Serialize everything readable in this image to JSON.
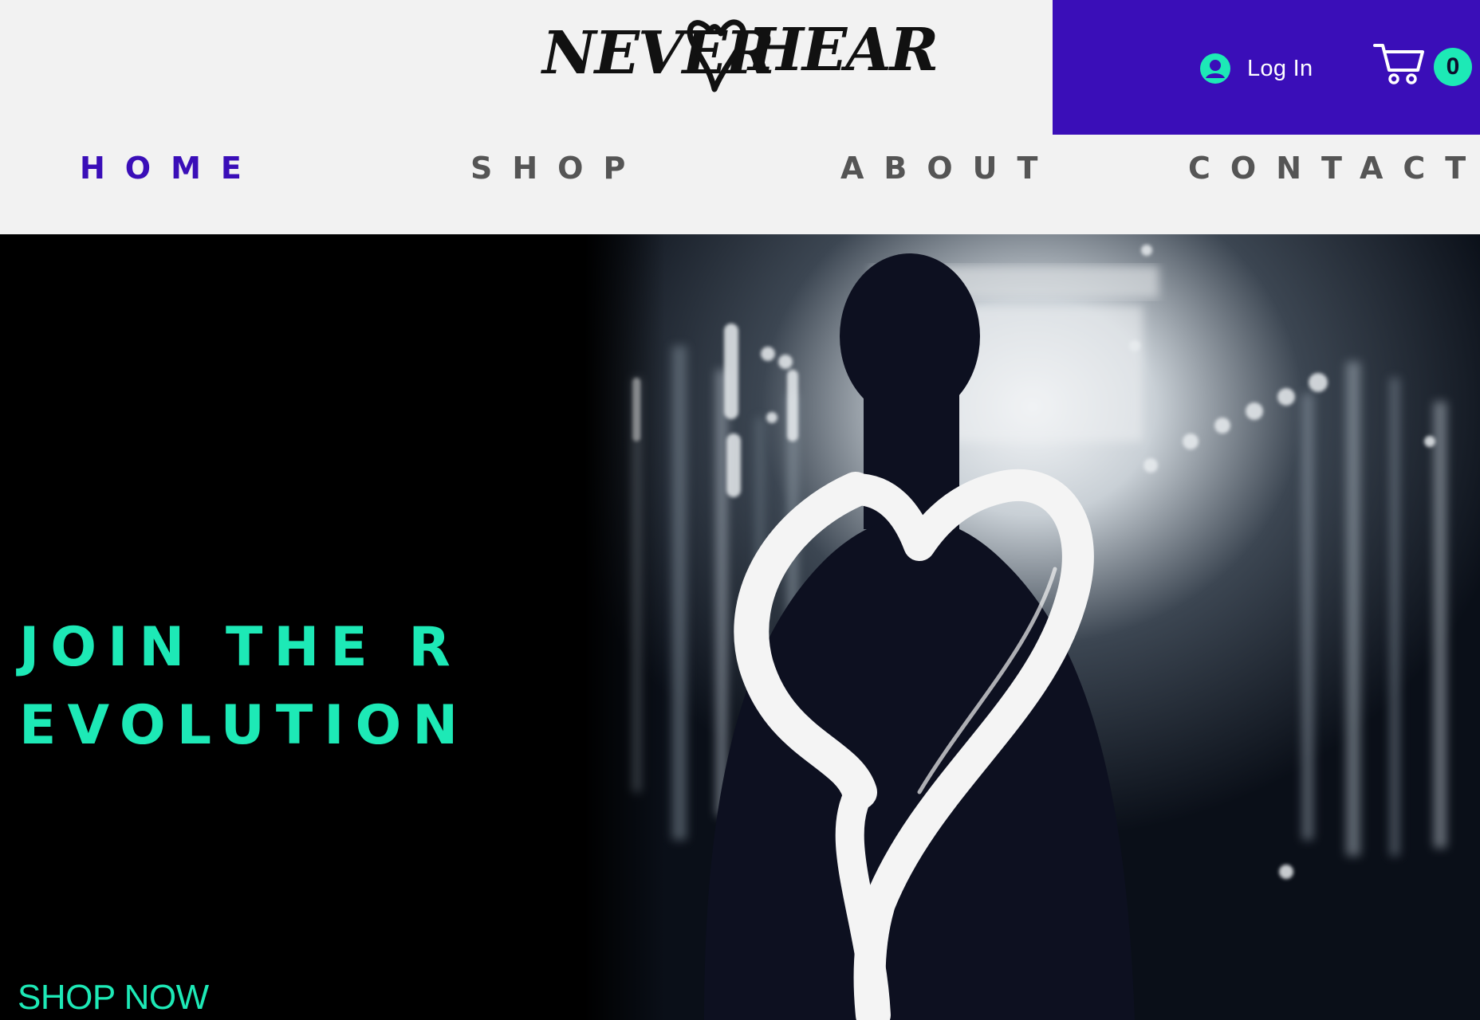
{
  "brand": {
    "logo_left": "NEVER",
    "logo_right": "HEART",
    "accent_color": "#3a0eb8",
    "highlight_color": "#1de9b6"
  },
  "account": {
    "login_label": "Log In",
    "user_icon": "user-icon",
    "cart_icon": "cart-icon",
    "cart_count": "0"
  },
  "nav": {
    "items": [
      {
        "label": "HOME",
        "active": true
      },
      {
        "label": "SHOP",
        "active": false
      },
      {
        "label": "ABOUT",
        "active": false
      },
      {
        "label": "CONTACT",
        "active": false
      }
    ]
  },
  "hero": {
    "headline": "JOIN THE REVOLUTION",
    "cta_label": "SHOP NOW",
    "image_subject": "silhouette-with-heart-stroke"
  }
}
